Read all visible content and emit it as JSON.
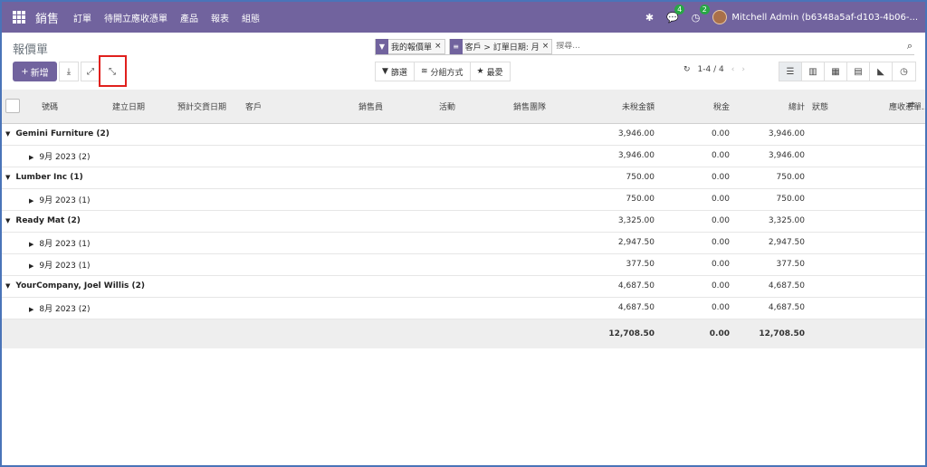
{
  "navbar": {
    "brand": "銷售",
    "menu": [
      "訂單",
      "待開立應收憑單",
      "產品",
      "報表",
      "組態"
    ],
    "messages_count": "4",
    "activities_count": "2",
    "user": "Mitchell Admin (b6348a5af-d103-4b06-..."
  },
  "control": {
    "title": "報價單",
    "new_label": "新增",
    "facets": [
      "我的報價單",
      "客戶 > 訂單日期: 月"
    ],
    "search_placeholder": "搜尋...",
    "filters_label": "篩選",
    "group_by_label": "分組方式",
    "favorites_label": "最愛",
    "pager": "1-4 / 4"
  },
  "table": {
    "columns": [
      "號碼",
      "建立日期",
      "預計交貨日期",
      "客戶",
      "銷售員",
      "活動",
      "銷售團隊",
      "未稅金額",
      "稅金",
      "總計",
      "狀態",
      "應收憑單..."
    ],
    "groups": [
      {
        "label": "Gemini Furniture (2)",
        "untaxed": "3,946.00",
        "tax": "0.00",
        "total": "3,946.00",
        "subgroups": [
          {
            "label": "9月 2023 (2)",
            "untaxed": "3,946.00",
            "tax": "0.00",
            "total": "3,946.00"
          }
        ]
      },
      {
        "label": "Lumber Inc (1)",
        "untaxed": "750.00",
        "tax": "0.00",
        "total": "750.00",
        "subgroups": [
          {
            "label": "9月 2023 (1)",
            "untaxed": "750.00",
            "tax": "0.00",
            "total": "750.00"
          }
        ]
      },
      {
        "label": "Ready Mat (2)",
        "untaxed": "3,325.00",
        "tax": "0.00",
        "total": "3,325.00",
        "subgroups": [
          {
            "label": "8月 2023 (1)",
            "untaxed": "2,947.50",
            "tax": "0.00",
            "total": "2,947.50"
          },
          {
            "label": "9月 2023 (1)",
            "untaxed": "377.50",
            "tax": "0.00",
            "total": "377.50"
          }
        ]
      },
      {
        "label": "YourCompany, Joel Willis (2)",
        "untaxed": "4,687.50",
        "tax": "0.00",
        "total": "4,687.50",
        "subgroups": [
          {
            "label": "8月 2023 (2)",
            "untaxed": "4,687.50",
            "tax": "0.00",
            "total": "4,687.50"
          }
        ]
      }
    ],
    "totals": {
      "untaxed": "12,708.50",
      "tax": "0.00",
      "total": "12,708.50"
    }
  },
  "colors": {
    "brand": "#71639e",
    "highlight": "#e0201d",
    "badge": "#28a745"
  }
}
